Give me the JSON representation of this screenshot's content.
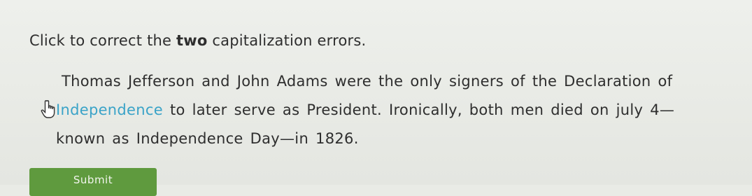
{
  "instruction": {
    "prefix": "Click to correct the ",
    "emphasis": "two",
    "suffix": " capitalization errors."
  },
  "passage": {
    "line1_words": [
      "Thomas",
      "Jefferson",
      "and",
      "John",
      "Adams",
      "were",
      "the",
      "only",
      "signers",
      "of",
      "the",
      "Declaration",
      "of"
    ],
    "line2_hover_word": "Independence",
    "line2_words": [
      "to",
      "later",
      "serve",
      "as",
      "President.",
      "Ironically,",
      "both",
      "men",
      "died",
      "on",
      "july",
      "4—"
    ],
    "line3_words": [
      "known",
      "as",
      "Independence",
      "Day—in",
      "1826."
    ]
  },
  "submit": {
    "label": "Submit"
  },
  "colors": {
    "hover_word": "#3aa3c8",
    "submit_bg": "#5f9a3e"
  },
  "icons": [
    "hand-pointer-icon"
  ]
}
